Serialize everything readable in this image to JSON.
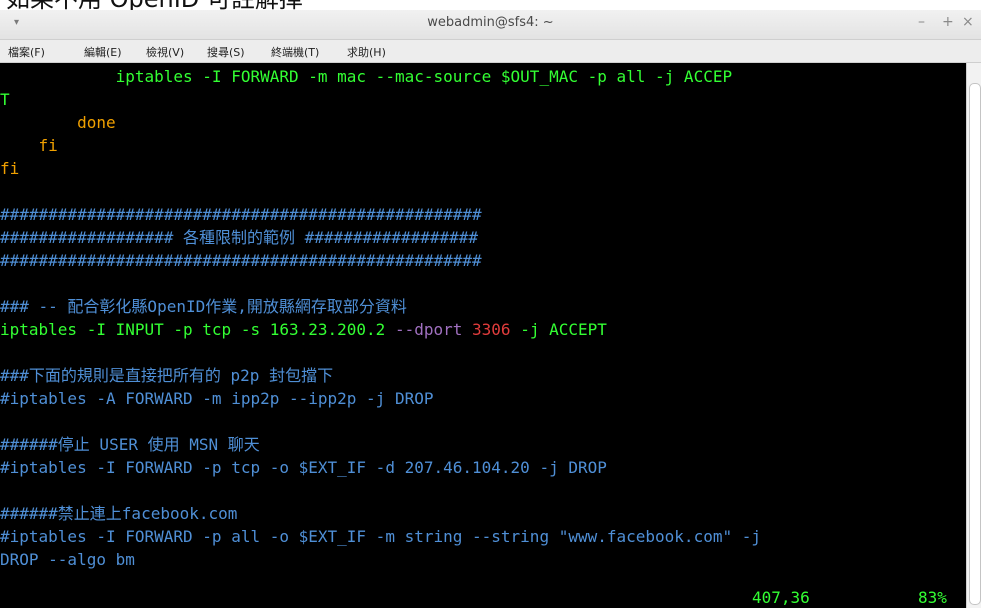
{
  "page_caption": "如果不用 OpenID 可註解掉",
  "window": {
    "title": "webadmin@sfs4: ~",
    "menu_arrow": "▾",
    "buttons": {
      "minimize": "–",
      "maximize": "+",
      "close": "×"
    }
  },
  "menubar": {
    "items": [
      "檔案(F)",
      "編輯(E)",
      "檢視(V)",
      "搜尋(S)",
      "終端機(T)",
      "求助(H)"
    ]
  },
  "terminal": {
    "l1": "            iptables -I FORWARD -m mac --mac-source $OUT_MAC -p all -j ACCEP",
    "l2": "T",
    "l3": "        done",
    "l4": "    fi",
    "l5": "fi",
    "l7": "##################################################",
    "l8": "################## 各種限制的範例 ##################",
    "l9": "##################################################",
    "l11": "### -- 配合彰化縣OpenID作業,開放縣網存取部分資料",
    "l12_a": "iptables -I INPUT -p tcp -s 163.23.200.2 ",
    "l12_b": "--dport",
    "l12_c": " 3306",
    "l12_d": " -j ACCEPT",
    "l14": "###下面的規則是直接把所有的 p2p 封包擋下",
    "l15": "#iptables -A FORWARD -m ipp2p --ipp2p -j DROP",
    "l17": "######停止 USER 使用 MSN 聊天",
    "l18": "#iptables -I FORWARD -p tcp -o $EXT_IF -d 207.46.104.20 -j DROP",
    "l20": "######禁止連上facebook.com",
    "l21": "#iptables -I FORWARD -p all -o $EXT_IF -m string --string \"www.facebook.com\" -j",
    "l22": "DROP --algo bm",
    "status_pos": "407,36",
    "status_pct": "83%"
  }
}
